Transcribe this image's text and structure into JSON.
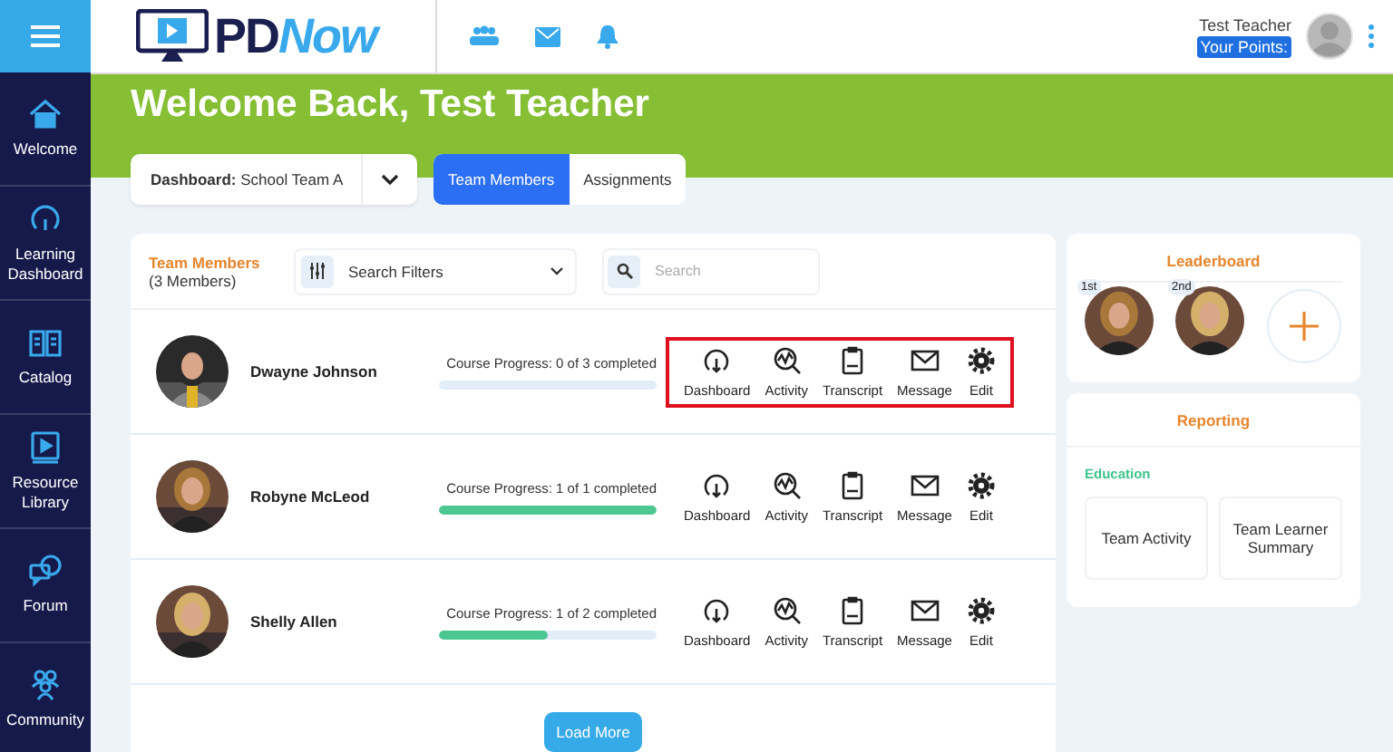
{
  "logo": {
    "part_1": "PD",
    "part_2": "Now"
  },
  "user": {
    "name": "Test Teacher",
    "points_label": "Your Points:"
  },
  "sidebar": {
    "items": [
      {
        "label": "Welcome",
        "kind": "home"
      },
      {
        "label": "Learning Dashboard",
        "kind": "gauge"
      },
      {
        "label": "Catalog",
        "kind": "book"
      },
      {
        "label": "Resource Library",
        "kind": "video"
      },
      {
        "label": "Forum",
        "kind": "chat"
      },
      {
        "label": "Community",
        "kind": "people"
      }
    ]
  },
  "banner": {
    "title": "Welcome Back, Test Teacher"
  },
  "dashboard_select": {
    "label": "Dashboard:",
    "value": "School Team A"
  },
  "tabs": [
    {
      "label": "Team Members",
      "selected": true
    },
    {
      "label": "Assignments",
      "selected": false
    }
  ],
  "team": {
    "title": "Team Members",
    "count": "(3 Members)",
    "filter": "Search Filters",
    "search_placeholder": "Search",
    "members": [
      {
        "name": "Dwayne Johnson",
        "progress": "Course Progress: 0 of 3 completed",
        "level": 0,
        "highlighted": true,
        "actions": [
          {
            "label": "Dashboard",
            "kind": "gauge"
          },
          {
            "label": "Activity",
            "kind": "activity"
          },
          {
            "label": "Transcript",
            "kind": "clipboard"
          },
          {
            "label": "Message",
            "kind": "mail"
          },
          {
            "label": "Edit",
            "kind": "gear"
          }
        ]
      },
      {
        "name": "Robyne McLeod",
        "progress": "Course Progress: 1 of 1 completed",
        "level": 1,
        "highlighted": false,
        "actions": [
          {
            "label": "Dashboard",
            "kind": "gauge"
          },
          {
            "label": "Activity",
            "kind": "activity"
          },
          {
            "label": "Transcript",
            "kind": "clipboard"
          },
          {
            "label": "Message",
            "kind": "mail"
          },
          {
            "label": "Edit",
            "kind": "gear"
          }
        ]
      },
      {
        "name": "Shelly Allen",
        "progress": "Course Progress: 1 of 2 completed",
        "level": 0.5,
        "highlighted": false,
        "actions": [
          {
            "label": "Dashboard",
            "kind": "gauge"
          },
          {
            "label": "Activity",
            "kind": "activity"
          },
          {
            "label": "Transcript",
            "kind": "clipboard"
          },
          {
            "label": "Message",
            "kind": "mail"
          },
          {
            "label": "Edit",
            "kind": "gear"
          }
        ]
      }
    ],
    "load_more": "Load More"
  },
  "leaderboard": {
    "title": "Leaderboard",
    "entries": [
      {
        "rank": "1st"
      },
      {
        "rank": "2nd"
      }
    ]
  },
  "reporting": {
    "title": "Reporting",
    "section": "Education",
    "reports": [
      "Team Activity",
      "Team Learner Summary"
    ]
  }
}
